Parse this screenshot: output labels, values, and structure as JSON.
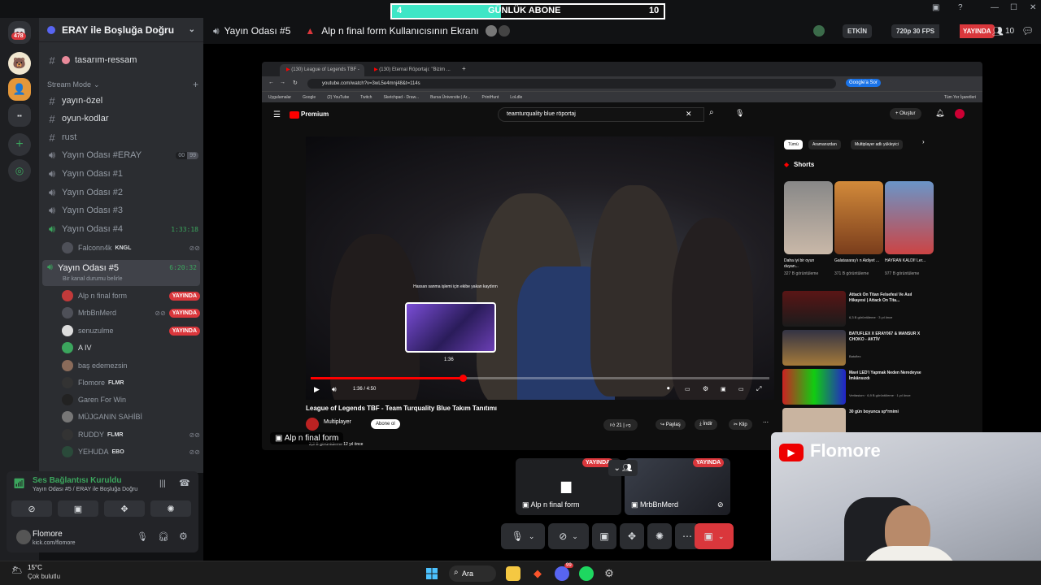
{
  "overlay": {
    "left_count": "4",
    "title": "GÜNLÜK ABONE",
    "right_count": "10",
    "progress": 0.4
  },
  "rail": {
    "badge": "478"
  },
  "sidebar": {
    "server_name": "ERAY ile Boşluğa Doğru",
    "top_channels": [
      {
        "name": "tasarım-ressam"
      }
    ],
    "category": "Stream Mode",
    "text_channels": [
      {
        "name": "yayın-özel"
      },
      {
        "name": "oyun-kodlar"
      },
      {
        "name": "rust"
      }
    ],
    "voice_channels": [
      {
        "name": "Yayın Odası #ERAY",
        "counter_a": "00",
        "counter_b": "99"
      },
      {
        "name": "Yayın Odası #1"
      },
      {
        "name": "Yayın Odası #2"
      },
      {
        "name": "Yayın Odası #3"
      },
      {
        "name": "Yayın Odası #4",
        "timer": "1:33:18"
      }
    ],
    "room4_user": {
      "name": "Falconn4k",
      "badge": "KNGL"
    },
    "active_room": {
      "name": "Yayın Odası #5",
      "timer": "6:20:32",
      "status": "Bir kanal durumu belirle"
    },
    "room5_users": [
      {
        "name": "Alp n final form",
        "live": "YAYINDA"
      },
      {
        "name": "MrbBnMerd",
        "live": "YAYINDA"
      },
      {
        "name": "senuzulme",
        "live": "YAYINDA"
      },
      {
        "name": "A IV"
      },
      {
        "name": "baş edemezsin"
      },
      {
        "name": "Flomore",
        "badge": "FLMR"
      },
      {
        "name": "Garen For Win"
      },
      {
        "name": "MÜJGANIN SAHİBİ"
      },
      {
        "name": "RUDDY",
        "badge": "FLMR"
      },
      {
        "name": "YEHUDA",
        "badge": "EBO"
      }
    ]
  },
  "voice_panel": {
    "status": "Ses Bağlantısı Kuruldu",
    "location": "Yayın Odası #5 / ERAY ile Boşluğa Doğru"
  },
  "user_panel": {
    "name": "Flomore",
    "subtitle": "kick.com/flomore"
  },
  "topbar": {
    "channel": "Yayın Odası #5",
    "stream_title": "Alp n final form Kullanıcısının Ekranı",
    "activity": "ETKİN",
    "quality": "720p 30 FPS",
    "live": "YAYINDA",
    "viewers": "10"
  },
  "browser": {
    "tab1": "(130) League of Legends TBF -",
    "tab2": "(130) Eternal Röportajı: \"Bizim ...",
    "url": "youtube.com/watch?v=3wL5e4mnj48&t=114s",
    "search_engine": "Google'a Sor",
    "bookmarks": [
      "Uygulamalar",
      "Google",
      "(2) YouTube",
      "Twitch",
      "Sketchpad - Draw...",
      "Bursa Üniversite | Ar...",
      "PrintHunt",
      "LoLdle"
    ],
    "all_bookmarks": "Tüm Yer İşaretleri"
  },
  "youtube": {
    "logo": "Premium",
    "search_query": "teamturquality blue röportaj",
    "create": "Oluştur",
    "time": "1:36 / 4:50",
    "hover_time": "1:36",
    "preview_caption": "Hassan sanma işlemi için ekibe yakan kaydırın",
    "title": "League of Legends TBF - Team Turquality Blue Takım Tanıtımı",
    "channel": "Multiplayer",
    "subscribe": "Abone ol",
    "likes": "21",
    "share": "Paylaş",
    "download": "İndir",
    "clip": "Klip",
    "views": "3,3 B görüntüleme  12 yıl önce",
    "chips": [
      "Tümü",
      "Aramanızdan",
      "Multiplayer adlı yükleyici"
    ],
    "shorts_title": "Shorts",
    "shorts": [
      {
        "title": "Daha iyi bir oyun duyan...",
        "views": "327 B görüntüleme"
      },
      {
        "title": "Galatasaray'ı n Aidiyet ...",
        "views": "371 B görüntüleme"
      },
      {
        "title": "HAYRAN KALDI! Ler...",
        "views": "977 B görüntüleme"
      }
    ],
    "related": [
      {
        "title": "Attack On Titan Felsefesi Ve Asıl Hikayesi | Attack On Tita...",
        "meta": "6,3 B görüntüleme · 3 yıl önce"
      },
      {
        "title": "BATUFLEX X ERAY067 & MANSUR X CHOKO - AKTİV",
        "meta": "Batuflex"
      },
      {
        "title": "Mavi LED'i Yapmak Neden Neredeyse İmkânsızdı",
        "meta": "Veritasium · 6,9 B görüntüleme · 1 yıl önce"
      },
      {
        "title": "30 gün boyunca sp*rmimi",
        "meta": ""
      }
    ]
  },
  "stream_label": "Alp n final form",
  "tiles": [
    {
      "name": "Alp n final form",
      "live": "YAYINDA"
    },
    {
      "name": "MrbBnMerd",
      "live": "YAYINDA"
    }
  ],
  "webcam": {
    "name": "Flomore"
  },
  "taskbar": {
    "search": "Ara",
    "weather_temp": "15°C",
    "weather_desc": "Çok bulutlu",
    "discord_badge": "99"
  },
  "colors": {
    "live": "#da373c",
    "green": "#3ba55d",
    "accent": "#5865f2",
    "cyan": "#3ee6c6"
  }
}
